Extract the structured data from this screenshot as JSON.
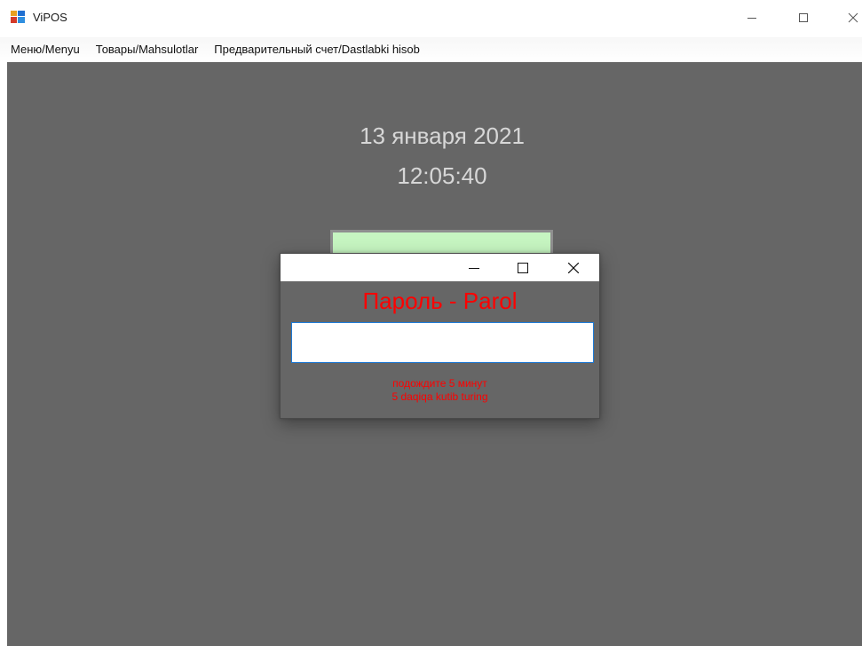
{
  "window": {
    "title": "ViPOS",
    "icon": "vipos-app-icon"
  },
  "menu": {
    "items": [
      {
        "label": "Меню/Menyu"
      },
      {
        "label": "Товары/Mahsulotlar"
      },
      {
        "label": "Предварительный счет/Dastlabki hisob"
      }
    ]
  },
  "main": {
    "date": "13 января 2021",
    "time": "12:05:40",
    "button_color": "#c6f5c1"
  },
  "dialog": {
    "heading": "Пароль - Parol",
    "password_value": "",
    "wait_ru": "подождите 5 минут",
    "wait_uz": "5 daqiqa kutib turing",
    "accent_color": "#ff0000"
  },
  "colors": {
    "background": "#666666",
    "clock_text": "#d7d7d7",
    "input_border": "#1e7ad6"
  }
}
